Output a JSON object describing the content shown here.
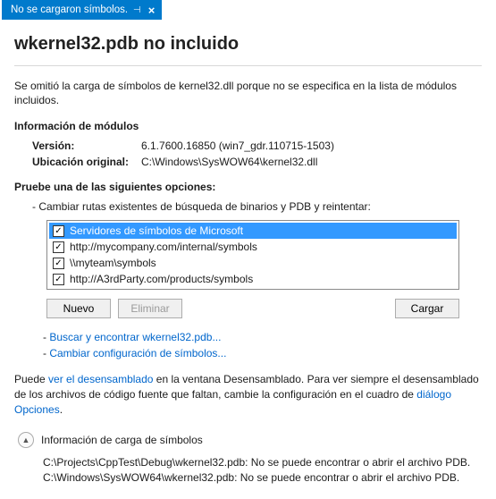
{
  "tab": {
    "title": "No se cargaron símbolos."
  },
  "heading": "wkernel32.pdb no incluido",
  "lead": "Se omitió la carga de símbolos de kernel32.dll porque no se especifica en la lista de módulos incluidos.",
  "module_info": {
    "title": "Información de módulos",
    "version_label": "Versión:",
    "version_value": "6.1.7600.16850 (win7_gdr.110715-1503)",
    "location_label": "Ubicación original:",
    "location_value": "C:\\Windows\\SysWOW64\\kernel32.dll"
  },
  "options": {
    "title": "Pruebe una de las siguientes opciones:",
    "search_lead": "- Cambiar rutas existentes de búsqueda de binarios y PDB y reintentar:",
    "items": [
      {
        "label": "Servidores de símbolos de Microsoft",
        "checked": true,
        "selected": true
      },
      {
        "label": "http://mycompany.com/internal/symbols",
        "checked": true,
        "selected": false
      },
      {
        "label": "\\\\myteam\\symbols",
        "checked": true,
        "selected": false
      },
      {
        "label": "http://A3rdParty.com/products/symbols",
        "checked": true,
        "selected": false
      }
    ],
    "btn_new": "Nuevo",
    "btn_delete": "Eliminar",
    "btn_load": "Cargar",
    "link_find_prefix": "- ",
    "link_find": "Buscar y encontrar wkernel32.pdb...",
    "link_settings_prefix": "- ",
    "link_settings": "Cambiar configuración de símbolos..."
  },
  "footer": {
    "part1": "Puede ",
    "link1": "ver el desensamblado",
    "part2": " en la ventana Desensamblado. Para ver siempre el desensamblado de los archivos de código fuente que faltan, cambie la configuración en el cuadro de ",
    "link2": "diálogo Opciones",
    "part3": "."
  },
  "loadinfo": {
    "title": "Información de carga de símbolos",
    "lines": [
      "C:\\Projects\\CppTest\\Debug\\wkernel32.pdb: No se puede encontrar o abrir el archivo PDB.",
      "C:\\Windows\\SysWOW64\\wkernel32.pdb: No se puede encontrar o abrir el archivo PDB."
    ]
  }
}
